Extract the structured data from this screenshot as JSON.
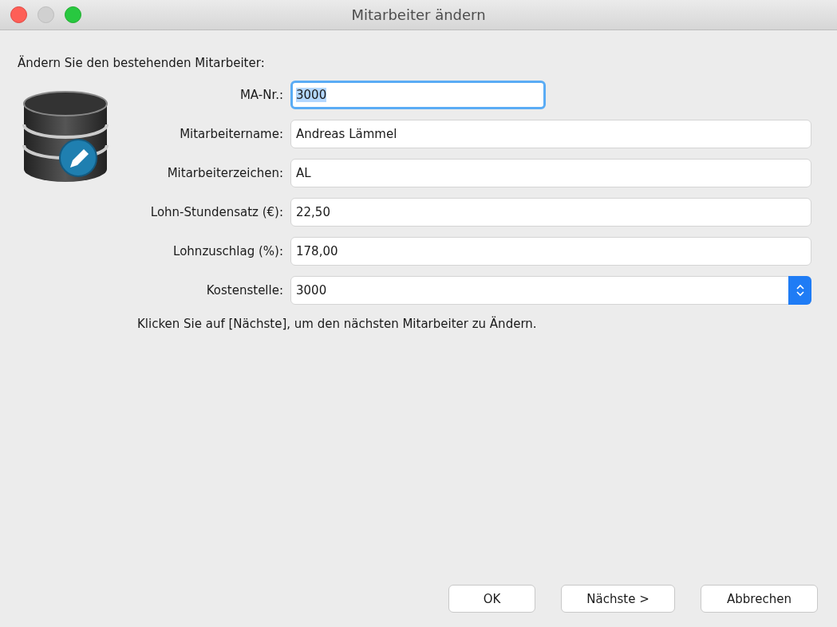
{
  "window": {
    "title": "Mitarbeiter ändern"
  },
  "intro": "Ändern Sie den bestehenden Mitarbeiter:",
  "fields": [
    {
      "label": "MA-Nr.:",
      "value": "3000",
      "kind": "text",
      "focused": true
    },
    {
      "label": "Mitarbeitername:",
      "value": "Andreas Lämmel",
      "kind": "text",
      "focused": false
    },
    {
      "label": "Mitarbeiterzeichen:",
      "value": "AL",
      "kind": "text",
      "focused": false
    },
    {
      "label": "Lohn-Stundensatz (€):",
      "value": "22,50",
      "kind": "text",
      "focused": false
    },
    {
      "label": "Lohnzuschlag (%):",
      "value": "178,00",
      "kind": "text",
      "focused": false
    },
    {
      "label": "Kostenstelle:",
      "value": "3000",
      "kind": "select",
      "focused": false
    }
  ],
  "hint": "Klicken Sie auf [Nächste], um den nächsten Mitarbeiter zu Ändern.",
  "buttons": [
    "OK",
    "Nächste >",
    "Abbrechen"
  ]
}
